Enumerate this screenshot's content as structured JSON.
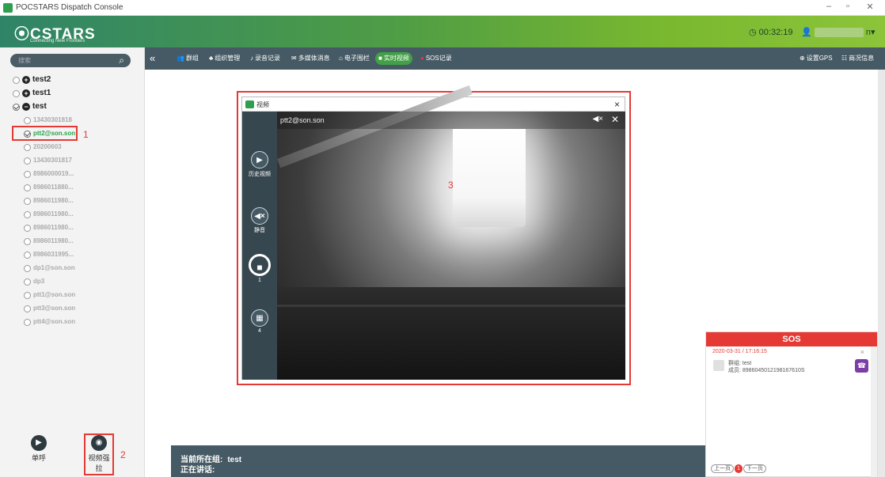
{
  "window": {
    "title": "POCSTARS Dispatch Console",
    "minimize": "–",
    "restore": "▫",
    "close": "✕"
  },
  "header": {
    "logo": "⦿CSTARS",
    "slogan": "Connecting New Frontiers",
    "timer": "◷ 00:32:19",
    "user_icon": "person-icon",
    "user_suffix": "n▾"
  },
  "sidebar": {
    "search_placeholder": "搜索",
    "tree": [
      {
        "label": "test2",
        "type": "group"
      },
      {
        "label": "test1",
        "type": "group"
      },
      {
        "label": "test",
        "type": "group",
        "expanded": true
      },
      {
        "label": "13430301818",
        "type": "member"
      },
      {
        "label": "ptt2@son.son",
        "type": "member",
        "checked": true,
        "active": true
      },
      {
        "label": "20200603",
        "type": "member"
      },
      {
        "label": "13430301817",
        "type": "member"
      },
      {
        "label": "8986000019...",
        "type": "member"
      },
      {
        "label": "8986011880...",
        "type": "member"
      },
      {
        "label": "8986011980...",
        "type": "member"
      },
      {
        "label": "8986011980...",
        "type": "member"
      },
      {
        "label": "8986011980...",
        "type": "member"
      },
      {
        "label": "8986011980...",
        "type": "member"
      },
      {
        "label": "8986031995...",
        "type": "member"
      },
      {
        "label": "dp1@son.son",
        "type": "member"
      },
      {
        "label": "dp3",
        "type": "member"
      },
      {
        "label": "ptt1@son.son",
        "type": "member"
      },
      {
        "label": "ptt3@son.son",
        "type": "member"
      },
      {
        "label": "ptt4@son.son",
        "type": "member"
      }
    ],
    "bottom": {
      "single_call": "单呼",
      "video_pull": "视频强拉"
    }
  },
  "annotations": {
    "n1": "1",
    "n2": "2",
    "n3": "3"
  },
  "navbar": {
    "collapse": "«",
    "items": [
      "群组",
      "组织管理",
      "录音记录",
      "多媒体消息",
      "电子围栏",
      "实时视频",
      "SOS记录"
    ],
    "right": [
      "设置GPS",
      "商况信息"
    ]
  },
  "status": {
    "group_label": "当前所在组:",
    "group_name": "test",
    "speaking_label": "正在讲话:"
  },
  "video_window": {
    "title": "视频",
    "user": "ptt2@son.son",
    "side": {
      "history": "历史视频",
      "mute": "静音",
      "stop_count": "1",
      "grid_count": "4"
    }
  },
  "sos": {
    "title": "SOS",
    "date": "2020-03-31 / 17:16:15",
    "group": "群组: test",
    "member": "成员: 8986045012198167610S",
    "pager": {
      "prev": "上一页",
      "current": "1",
      "next": "下一页"
    }
  },
  "colors": {
    "accent": "#43a047",
    "header_start": "#2f8468",
    "header_end": "#8cc43a",
    "nav": "#455a64",
    "alert": "#e53935"
  }
}
